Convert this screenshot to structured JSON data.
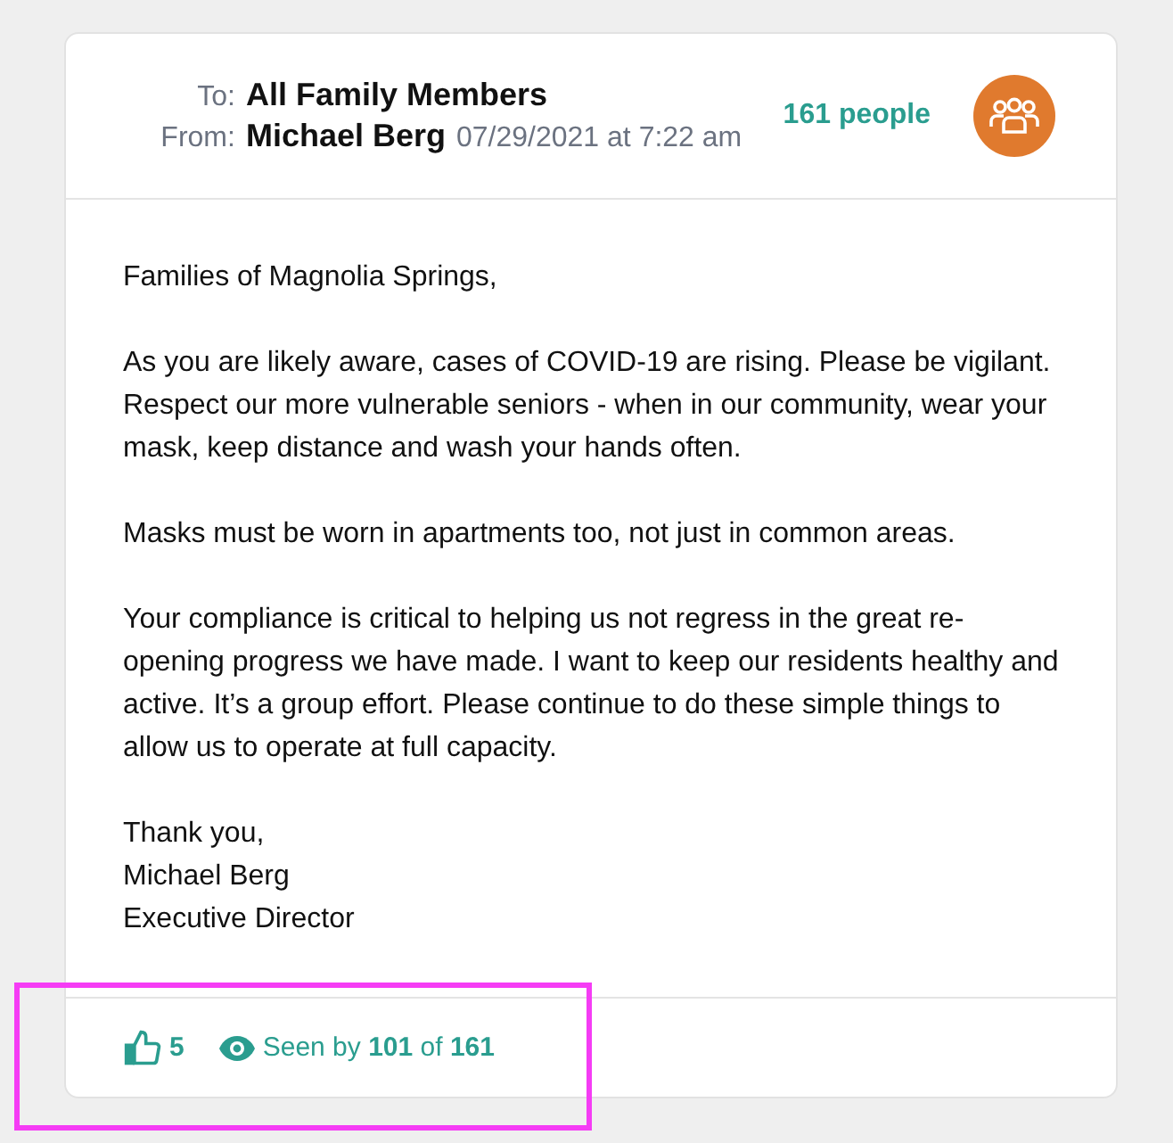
{
  "header": {
    "to_label": "To:",
    "to": "All Family Members",
    "from_label": "From:",
    "from": "Michael Berg",
    "date": "07/29/2021 at 7:22 am",
    "recipients": "161 people"
  },
  "message": {
    "paragraphs": [
      "Families of Magnolia Springs,",
      "As you are likely aware, cases of COVID-19 are rising. Please be vigilant. Respect our more vulnerable seniors - when in our community, wear your mask, keep distance and wash your hands often.",
      "Masks must be worn in apartments too, not just in common areas.",
      "Your compliance is critical to helping us not regress in the great re-opening progress we have made. I want to keep our residents healthy and active.  It’s a group effort. Please continue to do these simple things to allow us to operate at full capacity."
    ],
    "signature": [
      "Thank you,",
      "Michael Berg",
      "Executive Director"
    ]
  },
  "footer": {
    "likes": "5",
    "seen": "Seen by **101** of **161**"
  },
  "highlight": {
    "color": "#f53cf5"
  }
}
